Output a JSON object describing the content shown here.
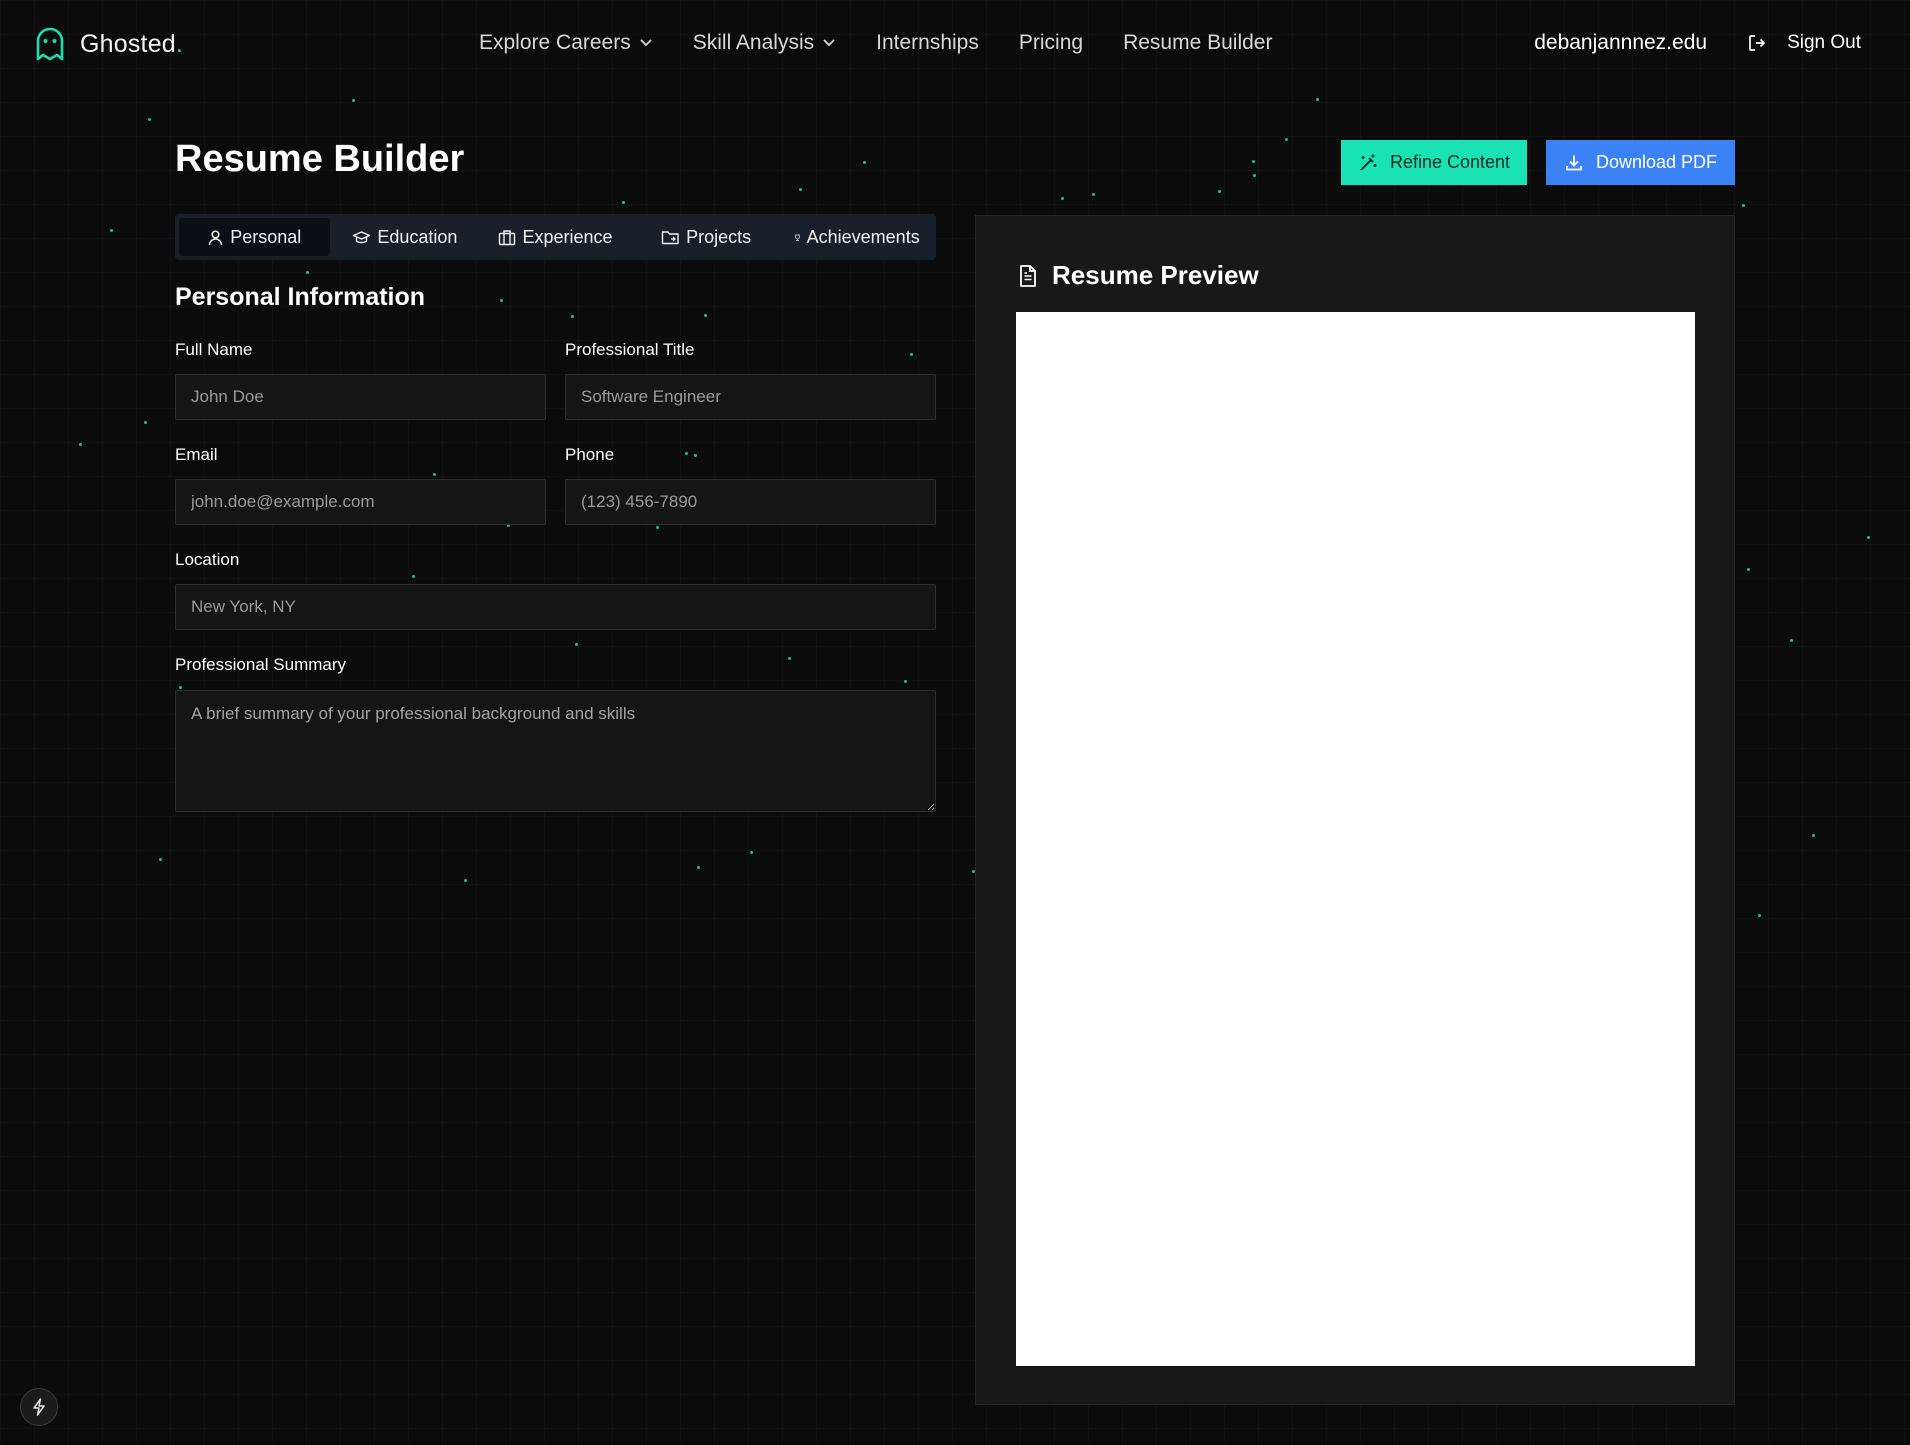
{
  "nav": {
    "brand": "Ghosted",
    "brand_dot": ".",
    "links": [
      {
        "label": "Explore Careers",
        "dropdown": true
      },
      {
        "label": "Skill Analysis",
        "dropdown": true
      },
      {
        "label": "Internships",
        "dropdown": false
      },
      {
        "label": "Pricing",
        "dropdown": false
      },
      {
        "label": "Resume Builder",
        "dropdown": false
      }
    ],
    "user_email": "debanjannnez.edu",
    "sign_out": "Sign Out"
  },
  "page": {
    "title": "Resume Builder",
    "refine_button": "Refine Content",
    "download_button": "Download PDF"
  },
  "tabs": [
    {
      "label": "Personal",
      "icon": "user-icon",
      "active": true
    },
    {
      "label": "Education",
      "icon": "graduation-cap-icon",
      "active": false
    },
    {
      "label": "Experience",
      "icon": "briefcase-icon",
      "active": false
    },
    {
      "label": "Projects",
      "icon": "folder-icon",
      "active": false
    },
    {
      "label": "Achievements",
      "icon": "trophy-icon",
      "active": false
    }
  ],
  "form": {
    "section_title": "Personal Information",
    "full_name": {
      "label": "Full Name",
      "placeholder": "John Doe",
      "value": ""
    },
    "professional_title": {
      "label": "Professional Title",
      "placeholder": "Software Engineer",
      "value": ""
    },
    "email": {
      "label": "Email",
      "placeholder": "john.doe@example.com",
      "value": ""
    },
    "phone": {
      "label": "Phone",
      "placeholder": "(123) 456-7890",
      "value": ""
    },
    "location": {
      "label": "Location",
      "placeholder": "New York, NY",
      "value": ""
    },
    "summary": {
      "label": "Professional Summary",
      "placeholder": "A brief summary of your professional background and skills",
      "value": ""
    }
  },
  "preview": {
    "title": "Resume Preview"
  },
  "colors": {
    "background": "#0b0b0b",
    "accent": "#19e3b5",
    "primary_blue": "#3b82f6",
    "tab_bar": "#18202c",
    "panel": "#181818"
  }
}
